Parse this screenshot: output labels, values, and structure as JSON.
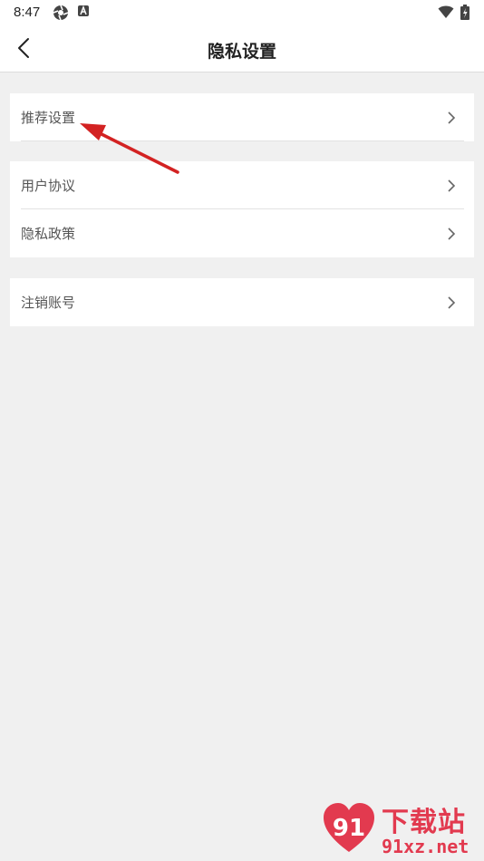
{
  "status_bar": {
    "time": "8:47"
  },
  "header": {
    "title": "隐私设置"
  },
  "sections": [
    {
      "items": [
        {
          "label": "推荐设置"
        }
      ]
    },
    {
      "items": [
        {
          "label": "用户协议"
        },
        {
          "label": "隐私政策"
        }
      ]
    },
    {
      "items": [
        {
          "label": "注销账号"
        }
      ]
    }
  ],
  "watermark": {
    "brand": "下载站",
    "site": "91xz.net"
  },
  "colors": {
    "annotation_arrow": "#d32222",
    "background": "#f0f0f0"
  }
}
